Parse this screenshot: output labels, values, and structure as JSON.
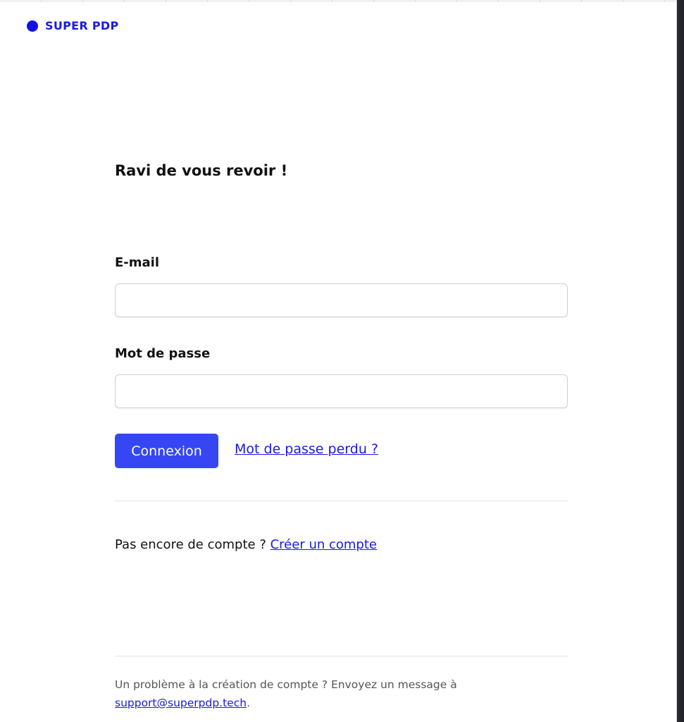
{
  "brand": {
    "name": "SUPER PDP",
    "color": "#1212e6"
  },
  "login": {
    "title": "Ravi de vous revoir !",
    "email_label": "E-mail",
    "email_value": "",
    "password_label": "Mot de passe",
    "password_value": "",
    "submit_label": "Connexion",
    "forgot_link": "Mot de passe perdu ?"
  },
  "signup": {
    "prompt": "Pas encore de compte ?",
    "link": "Créer un compte"
  },
  "help": {
    "text": "Un problème à la création de compte ? Envoyez un message à",
    "email": "support@superpdp.tech",
    "suffix": "."
  },
  "colors": {
    "primary_button": "#3646f4",
    "link": "#1a1ae0",
    "divider": "#e2e2e2"
  }
}
